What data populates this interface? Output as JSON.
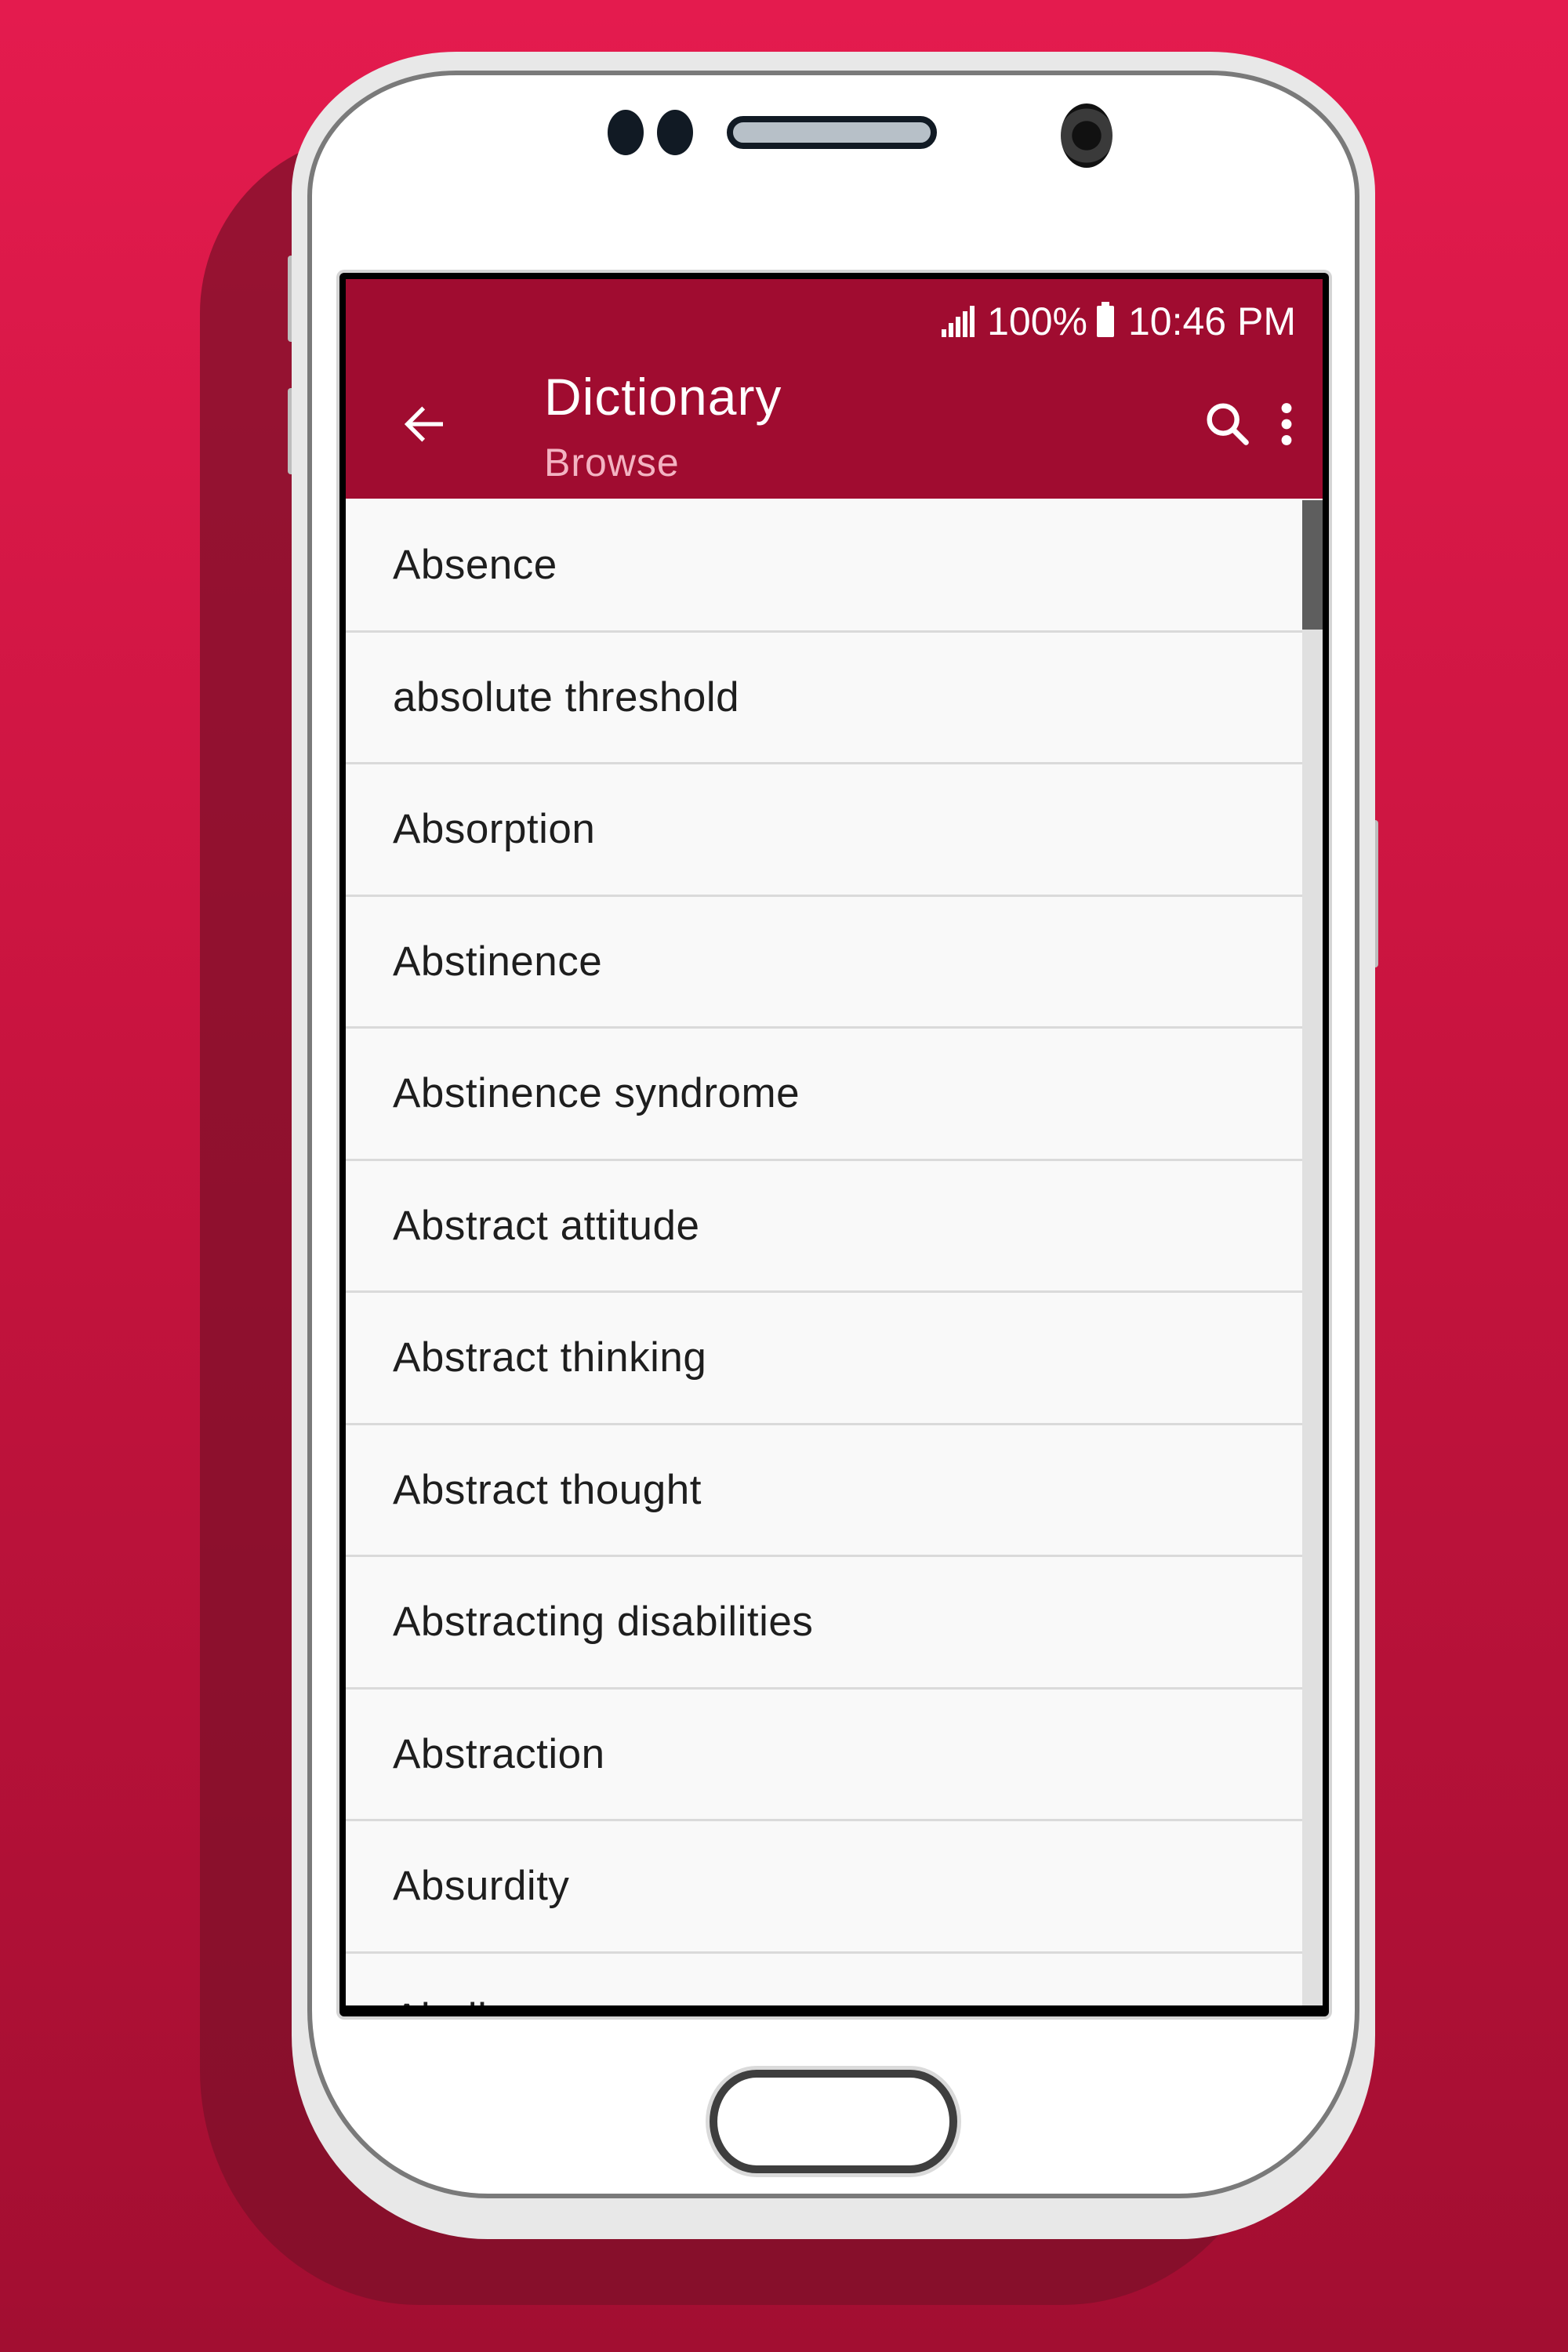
{
  "status_bar": {
    "battery": "100%",
    "time": "10:46 PM",
    "icons": [
      "signal-icon",
      "battery-icon"
    ]
  },
  "app_bar": {
    "title": "Dictionary",
    "subtitle": "Browse",
    "back_icon": "arrow-left-icon",
    "search_icon": "search-icon",
    "menu_icon": "more-vert-icon"
  },
  "list": {
    "items": [
      "Absence",
      "absolute threshold",
      "Absorption",
      "Abstinence",
      "Abstinence syndrome",
      "Abstract attitude",
      "Abstract thinking",
      "Abstract thought",
      "Abstracting disabilities",
      "Abstraction",
      "Absurdity",
      "Abulia"
    ]
  },
  "colors": {
    "background": "#D4164A",
    "app_bar": "#A00C30",
    "subtitle": "#F3B3C2",
    "list_background": "#F9F9F9",
    "divider": "#DADADA"
  }
}
